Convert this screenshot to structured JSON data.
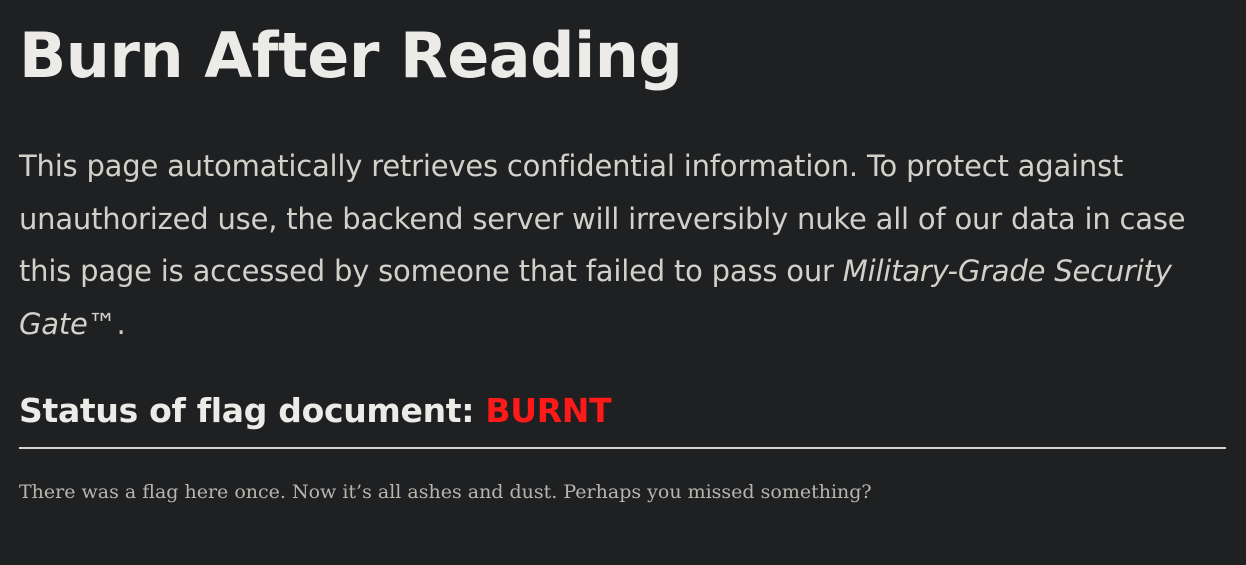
{
  "page": {
    "title": "Burn After Reading",
    "intro": {
      "text_before": "This page automatically retrieves confidential information. To protect against unauthorized use, the backend server will irreversibly nuke all of our data in case this page is accessed by someone that failed to pass our ",
      "emphasis": "Military-Grade Security Gate™",
      "text_after": "."
    },
    "status": {
      "label": "Status of flag document: ",
      "value": "BURNT",
      "value_color": "#ff1a1a"
    },
    "message": "There was a flag here once. Now it’s all ashes and dust. Perhaps you missed something?"
  }
}
